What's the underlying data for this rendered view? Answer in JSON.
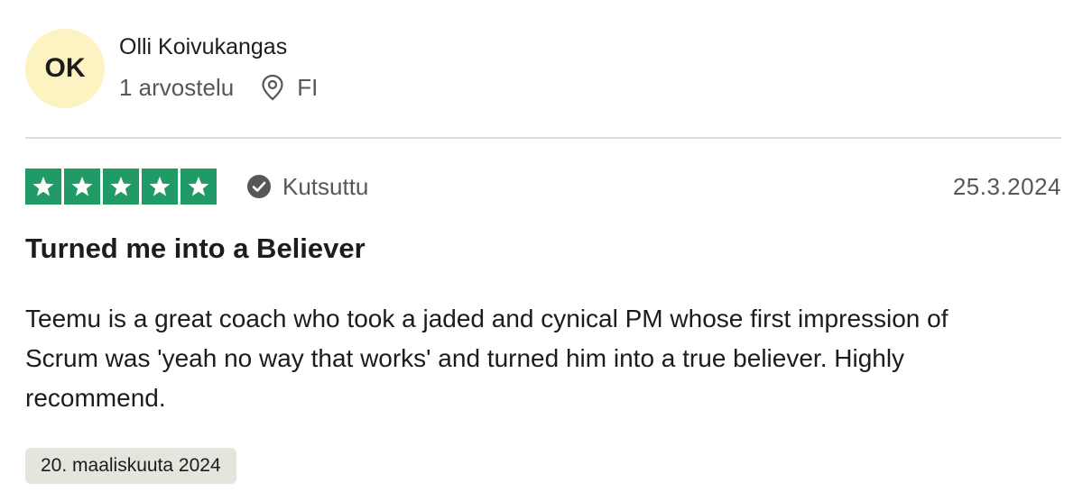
{
  "reviewer": {
    "initials": "OK",
    "avatar_color": "#fdf2c1",
    "name": "Olli Koivukangas",
    "review_count": "1 arvostelu",
    "location_icon": "location-pin-icon",
    "country": "FI"
  },
  "review": {
    "rating": 5,
    "rating_max": 5,
    "star_color": "#219a66",
    "verified_icon": "check-circle-icon",
    "verified_label": "Kutsuttu",
    "date": "25.3.2024",
    "title": "Turned me into a Believer",
    "text": "Teemu is a great coach who took a jaded and cynical PM whose first impression of Scrum was 'yeah no way that works' and turned him into a true believer. Highly recommend.",
    "experience_date": "20. maaliskuuta 2024",
    "experience_date_bg": "#e5e5dd"
  }
}
